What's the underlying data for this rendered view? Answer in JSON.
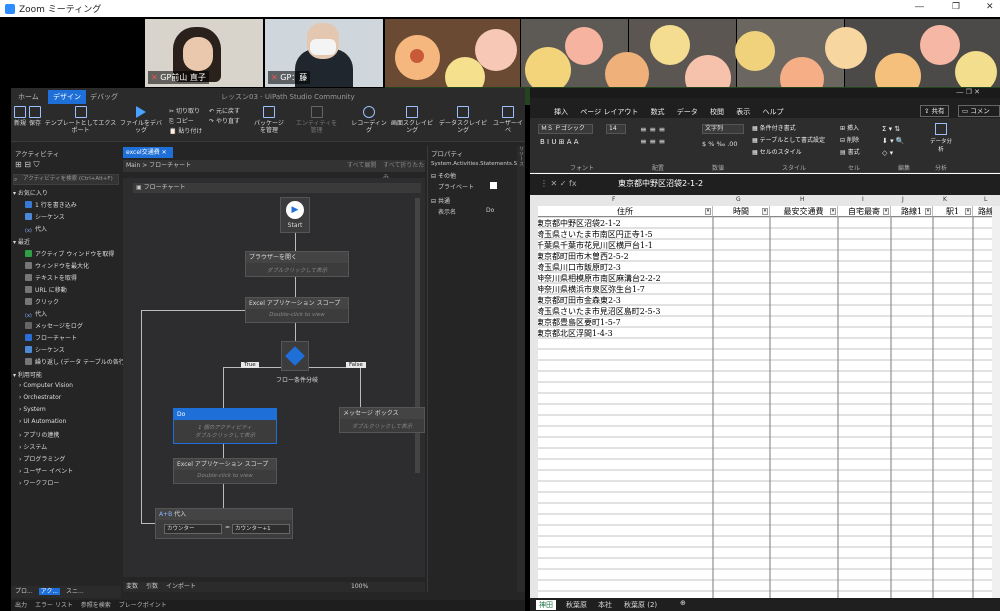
{
  "zoom": {
    "title": "Zoom ミーティング",
    "participants": [
      {
        "name": "GP前山 直子"
      },
      {
        "name": "GP：藤"
      }
    ]
  },
  "uipath": {
    "window_title": "レッスン03 - UiPath Studio Community",
    "tabs": [
      "ホーム",
      "デザイン",
      "デバッグ"
    ],
    "ribbon": [
      "新規",
      "保存",
      "テンプレートとしてエクスポート",
      "ファイルをデバッグ",
      "切り取り",
      "コピー",
      "貼り付け",
      "元に戻す",
      "やり直す",
      "パッケージを管理",
      "エンティティを管理",
      "レコーディング",
      "画面スクレイピング",
      "データスクレイピング",
      "ユーザーイベ"
    ],
    "activities_panel": {
      "title": "アクティビティ",
      "search_placeholder": "アクティビティを検索 (Ctrl+Alt+F)",
      "sections": [
        {
          "label": "お気に入り",
          "items": [
            "1 行を書き込み",
            "シーケンス",
            "代入"
          ]
        },
        {
          "label": "最近",
          "items": [
            "アクティブ ウィンドウを取得",
            "ウィンドウを最大化",
            "テキストを取得",
            "URL に移動",
            "クリック",
            "代入",
            "メッセージをログ",
            "フローチャート",
            "シーケンス",
            "繰り返し (データ テーブルの各行)"
          ]
        },
        {
          "label": "利用可能",
          "items": [
            "Computer Vision",
            "Orchestrator",
            "System",
            "UI Automation",
            "アプリの連携",
            "システム",
            "プログラミング",
            "ユーザー イベント",
            "ワークフロー"
          ]
        }
      ]
    },
    "doc_tab": "excel交通費",
    "breadcrumb": "Main > フローチャート",
    "expand_all": "すべて展開",
    "collapse_all": "すべて折りたたみ",
    "flowchart_label": "フローチャート",
    "flow": {
      "start": "Start",
      "open_browser": "ブラウザーを開く",
      "open_browser_hint": "ダブルクリックして表示",
      "excel_scope": "Excel アプリケーション スコープ",
      "excel_scope_hint": "Double-click to view",
      "decision": "フロー条件分岐",
      "true_label": "True",
      "false_label": "False",
      "do": "Do",
      "do_hint1": "1 個のアクティビティ",
      "do_hint2": "ダブルクリックして表示",
      "message_box": "メッセージ ボックス",
      "message_hint": "ダブルクリックして表示",
      "excel_scope2": "Excel アプリケーション スコープ",
      "excel_scope2_hint": "Double-click to view",
      "assign": "代入",
      "assign_left": "カウンター",
      "assign_right": "カウンター+1"
    },
    "properties": {
      "title": "プロパティ",
      "type": "System.Activities.Statements.S...",
      "misc": "その他",
      "private": "プライベート",
      "common": "共通",
      "display_name_label": "表示名",
      "display_name_value": "Do"
    },
    "bottom_tabs": [
      "変数",
      "引数",
      "インポート"
    ],
    "zoom_level": "100%",
    "left_bottom_tabs": [
      "プロ...",
      "アク...",
      "スニ..."
    ],
    "status_tabs": [
      "出力",
      "エラー リスト",
      "参照を検索",
      "ブレークポイント"
    ],
    "right_rail": "リソース"
  },
  "excel": {
    "tabs": [
      "挿入",
      "ページ レイアウト",
      "数式",
      "データ",
      "校閲",
      "表示",
      "ヘルプ"
    ],
    "share": "共有",
    "comment": "コメント",
    "font_name": "ＭＳ Ｐゴシック",
    "font_size": "14",
    "number_format": "文字列",
    "ribbon_items": [
      "条件付き書式",
      "テーブルとして書式設定",
      "セルのスタイル",
      "挿入",
      "削除",
      "書式"
    ],
    "ribbon_analysis": "データ分析",
    "groups": [
      "フォント",
      "配置",
      "数値",
      "スタイル",
      "セル",
      "編集",
      "分析"
    ],
    "formula": "東京都中野区沼袋2-1-2",
    "columns": [
      "F",
      "G",
      "H",
      "I",
      "J",
      "K",
      "L"
    ],
    "headers": [
      "住所",
      "時間",
      "最安交通費",
      "自宅最寄",
      "路線1",
      "駅1",
      "路線"
    ],
    "rows": [
      "東京都中野区沼袋2-1-2",
      "埼玉県さいたま市南区円正寺1-5",
      "千葉県千葉市花見川区横戸台1-1",
      "東京都町田市木曽西2-5-2",
      "埼玉県川口市飯原町2-3",
      "神奈川県相模原市南区麻溝台2-2-2",
      "神奈川県横浜市泉区弥生台1-7",
      "東京都町田市金森東2-3",
      "埼玉県さいたま市見沼区島町2-5-3",
      "東京都豊島区要町1-5-7",
      "東京都北区浮間1-4-3"
    ],
    "sheets": [
      "神田",
      "秋葉原",
      "本社",
      "秋葉原 (2)"
    ]
  }
}
